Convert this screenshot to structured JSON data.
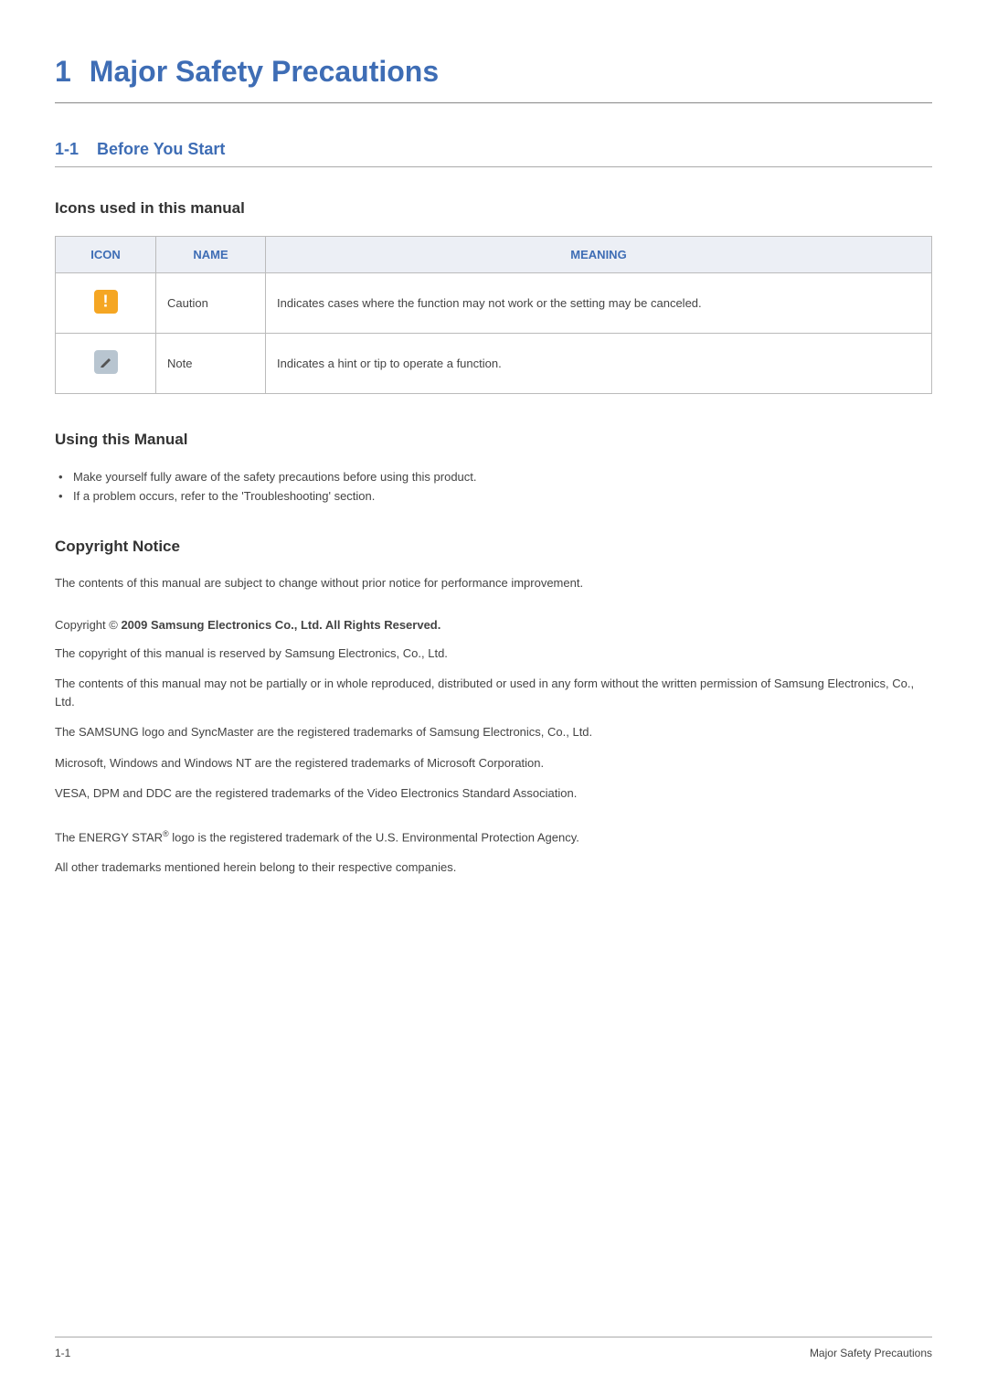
{
  "chapter": {
    "num": "1",
    "title": "Major Safety Precautions"
  },
  "section": {
    "num": "1-1",
    "title": "Before You Start"
  },
  "table_section": {
    "heading": "Icons used in this manual",
    "headers": {
      "icon": "ICON",
      "name": "NAME",
      "meaning": "MEANING"
    },
    "rows": [
      {
        "icon_name": "caution-icon",
        "name": "Caution",
        "meaning": "Indicates cases where the function may not work or the setting may be canceled."
      },
      {
        "icon_name": "note-icon",
        "name": "Note",
        "meaning": "Indicates a hint or tip to operate a function."
      }
    ]
  },
  "using_manual": {
    "heading": "Using this Manual",
    "items": [
      "Make yourself fully aware of the safety precautions before using this product.",
      "If a problem occurs, refer to the 'Troubleshooting' section."
    ]
  },
  "copyright": {
    "heading": "Copyright Notice",
    "intro": "The contents of this manual are subject to change without prior notice for performance improvement.",
    "line_prefix": "Copyright © ",
    "line_bold": "2009 Samsung Electronics Co., Ltd. All Rights Reserved.",
    "p1": "The copyright of this manual is reserved by Samsung Electronics, Co., Ltd.",
    "p2": "The contents of this manual may not be partially or in whole reproduced, distributed or used in any form without the written permission of Samsung Electronics, Co., Ltd.",
    "p3": "The SAMSUNG logo and SyncMaster are the registered trademarks of Samsung Electronics, Co., Ltd.",
    "p4": "Microsoft, Windows and Windows NT are the registered trademarks of Microsoft Corporation.",
    "p5": "VESA, DPM and DDC are the registered trademarks of the Video Electronics Standard Association.",
    "energy_pre": "The ENERGY STAR",
    "energy_sup": "®",
    "energy_post": " logo is the registered trademark of the U.S. Environmental Protection Agency.",
    "p6": "All other trademarks mentioned herein belong to their respective companies."
  },
  "footer": {
    "left": "1-1",
    "right": "Major Safety Precautions"
  }
}
